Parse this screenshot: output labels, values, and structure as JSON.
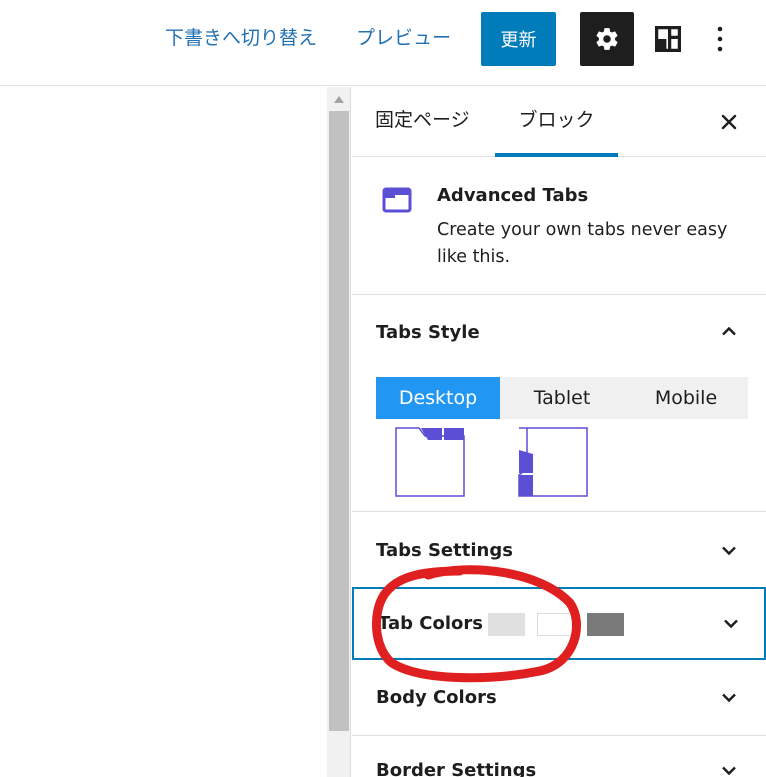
{
  "toolbar": {
    "switch_to_draft": "下書きへ切り替え",
    "preview": "プレビュー",
    "update": "更新",
    "settings_icon": "gear-icon",
    "block_layout_icon": "layout-icon",
    "more_icon": "more-vertical-icon"
  },
  "sidebar": {
    "tabs": [
      {
        "label": "固定ページ",
        "active": false
      },
      {
        "label": "ブロック",
        "active": true
      }
    ],
    "close_icon": "close-icon",
    "block": {
      "title": "Advanced Tabs",
      "description": "Create your own tabs never easy like this."
    },
    "panels": {
      "tabs_style": {
        "title": "Tabs Style",
        "expanded": true,
        "devices": [
          "Desktop",
          "Tablet",
          "Mobile"
        ],
        "selected_device": "Desktop"
      },
      "tabs_settings": {
        "title": "Tabs Settings",
        "expanded": false
      },
      "tab_colors": {
        "title": "Tab Colors",
        "expanded": false,
        "swatches": [
          "#e0e0e0",
          "#ffffff",
          "#7a7a7a"
        ]
      },
      "body_colors": {
        "title": "Body Colors",
        "expanded": false
      },
      "border_settings": {
        "title": "Border Settings",
        "expanded": false
      }
    }
  },
  "colors": {
    "accent": "#007cba",
    "link": "#2271b1",
    "device_active": "#2196f3",
    "block_icon": "#5b4fd6",
    "annotation": "#e02020"
  }
}
